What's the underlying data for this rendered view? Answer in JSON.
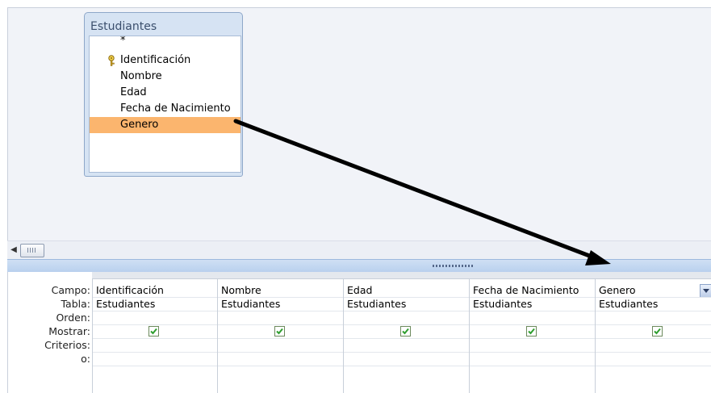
{
  "table_pane": {
    "table_name": "Estudiantes",
    "fields": [
      {
        "label": "*",
        "key": false,
        "selected": false
      },
      {
        "label": "Identificación",
        "key": true,
        "selected": false
      },
      {
        "label": "Nombre",
        "key": false,
        "selected": false
      },
      {
        "label": "Edad",
        "key": false,
        "selected": false
      },
      {
        "label": "Fecha de Nacimiento",
        "key": false,
        "selected": false
      },
      {
        "label": "Genero",
        "key": false,
        "selected": true
      }
    ]
  },
  "grid": {
    "row_labels": [
      "Campo:",
      "Tabla:",
      "Orden:",
      "Mostrar:",
      "Criterios:",
      "o:"
    ],
    "columns": [
      {
        "campo": "Identificación",
        "tabla": "Estudiantes",
        "mostrar": true
      },
      {
        "campo": "Nombre",
        "tabla": "Estudiantes",
        "mostrar": true
      },
      {
        "campo": "Edad",
        "tabla": "Estudiantes",
        "mostrar": true
      },
      {
        "campo": "Fecha de Nacimiento",
        "tabla": "Estudiantes",
        "mostrar": true
      },
      {
        "campo": "Genero",
        "tabla": "Estudiantes",
        "mostrar": true
      }
    ]
  },
  "colors": {
    "selected_field": "#fbb56e",
    "check": "#2e9e2e",
    "arrow": "#000000"
  },
  "icons": {
    "key": "key-icon",
    "scroll_left": "scroll-left-arrow-icon",
    "dropdown": "chevron-down-icon"
  }
}
